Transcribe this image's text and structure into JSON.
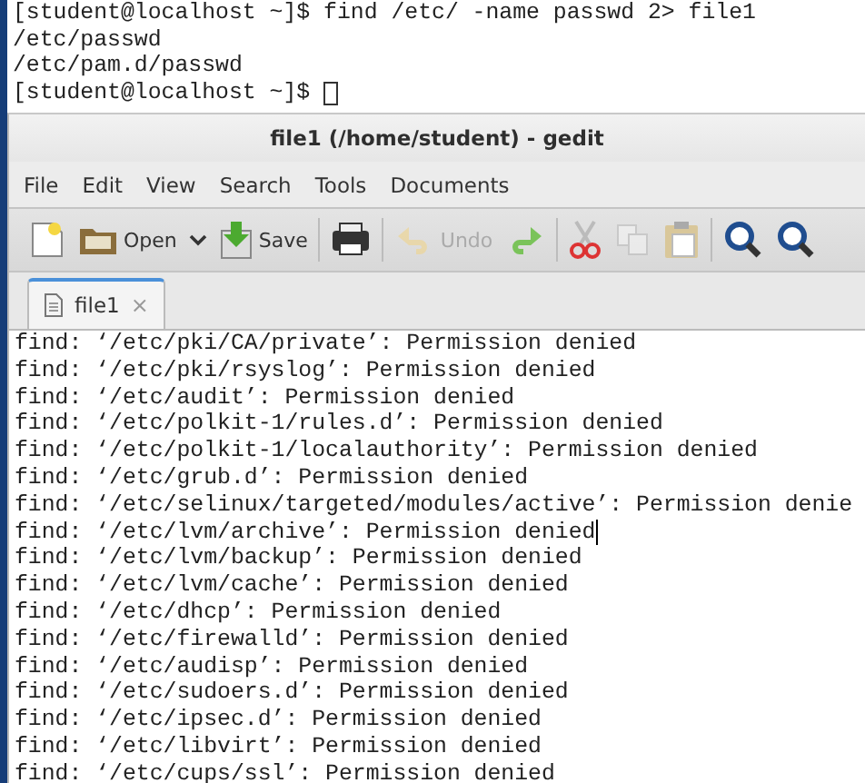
{
  "terminal": {
    "lines": [
      {
        "text": "[student@localhost ~]$ find /etc/ -name passwd 2> file1",
        "cursor": false
      },
      {
        "text": "/etc/passwd",
        "cursor": false
      },
      {
        "text": "/etc/pam.d/passwd",
        "cursor": false
      },
      {
        "text": "[student@localhost ~]$",
        "cursor": true
      }
    ]
  },
  "window": {
    "title": "file1 (/home/student) - gedit"
  },
  "menu": [
    "File",
    "Edit",
    "View",
    "Search",
    "Tools",
    "Documents"
  ],
  "toolbar": [
    {
      "kind": "new",
      "disabled": false
    },
    {
      "kind": "open",
      "label": "Open",
      "disabled": false
    },
    {
      "kind": "save",
      "label": "Save",
      "disabled": false
    },
    {
      "kind": "separator"
    },
    {
      "kind": "print",
      "disabled": false
    },
    {
      "kind": "separator"
    },
    {
      "kind": "undo",
      "label": "Undo",
      "disabled": true
    },
    {
      "kind": "redo",
      "disabled": false
    },
    {
      "kind": "separator"
    },
    {
      "kind": "cut",
      "disabled": false
    },
    {
      "kind": "copy",
      "disabled": true
    },
    {
      "kind": "paste",
      "disabled": false
    },
    {
      "kind": "separator"
    },
    {
      "kind": "find",
      "disabled": false
    },
    {
      "kind": "find",
      "disabled": false
    }
  ],
  "tabs": [
    {
      "label": "file1",
      "close": "×",
      "selected": true
    }
  ],
  "editor": {
    "lines": [
      {
        "text": "find: ‘/etc/pki/CA/private’: Permission denied",
        "cursor": false
      },
      {
        "text": "find: ‘/etc/pki/rsyslog’: Permission denied",
        "cursor": false
      },
      {
        "text": "find: ‘/etc/audit’: Permission denied",
        "cursor": false
      },
      {
        "text": "find: ‘/etc/polkit-1/rules.d’: Permission denied",
        "cursor": false
      },
      {
        "text": "find: ‘/etc/polkit-1/localauthority’: Permission denied",
        "cursor": false
      },
      {
        "text": "find: ‘/etc/grub.d’: Permission denied",
        "cursor": false
      },
      {
        "text": "find: ‘/etc/selinux/targeted/modules/active’: Permission denie",
        "cursor": false
      },
      {
        "text": "find: ‘/etc/lvm/archive’: Permission denied",
        "cursor": true
      },
      {
        "text": "find: ‘/etc/lvm/backup’: Permission denied",
        "cursor": false
      },
      {
        "text": "find: ‘/etc/lvm/cache’: Permission denied",
        "cursor": false
      },
      {
        "text": "find: ‘/etc/dhcp’: Permission denied",
        "cursor": false
      },
      {
        "text": "find: ‘/etc/firewalld’: Permission denied",
        "cursor": false
      },
      {
        "text": "find: ‘/etc/audisp’: Permission denied",
        "cursor": false
      },
      {
        "text": "find: ‘/etc/sudoers.d’: Permission denied",
        "cursor": false
      },
      {
        "text": "find: ‘/etc/ipsec.d’: Permission denied",
        "cursor": false
      },
      {
        "text": "find: ‘/etc/libvirt’: Permission denied",
        "cursor": false
      },
      {
        "text": "find: ‘/etc/cups/ssl’: Permission denied",
        "cursor": false
      }
    ]
  }
}
